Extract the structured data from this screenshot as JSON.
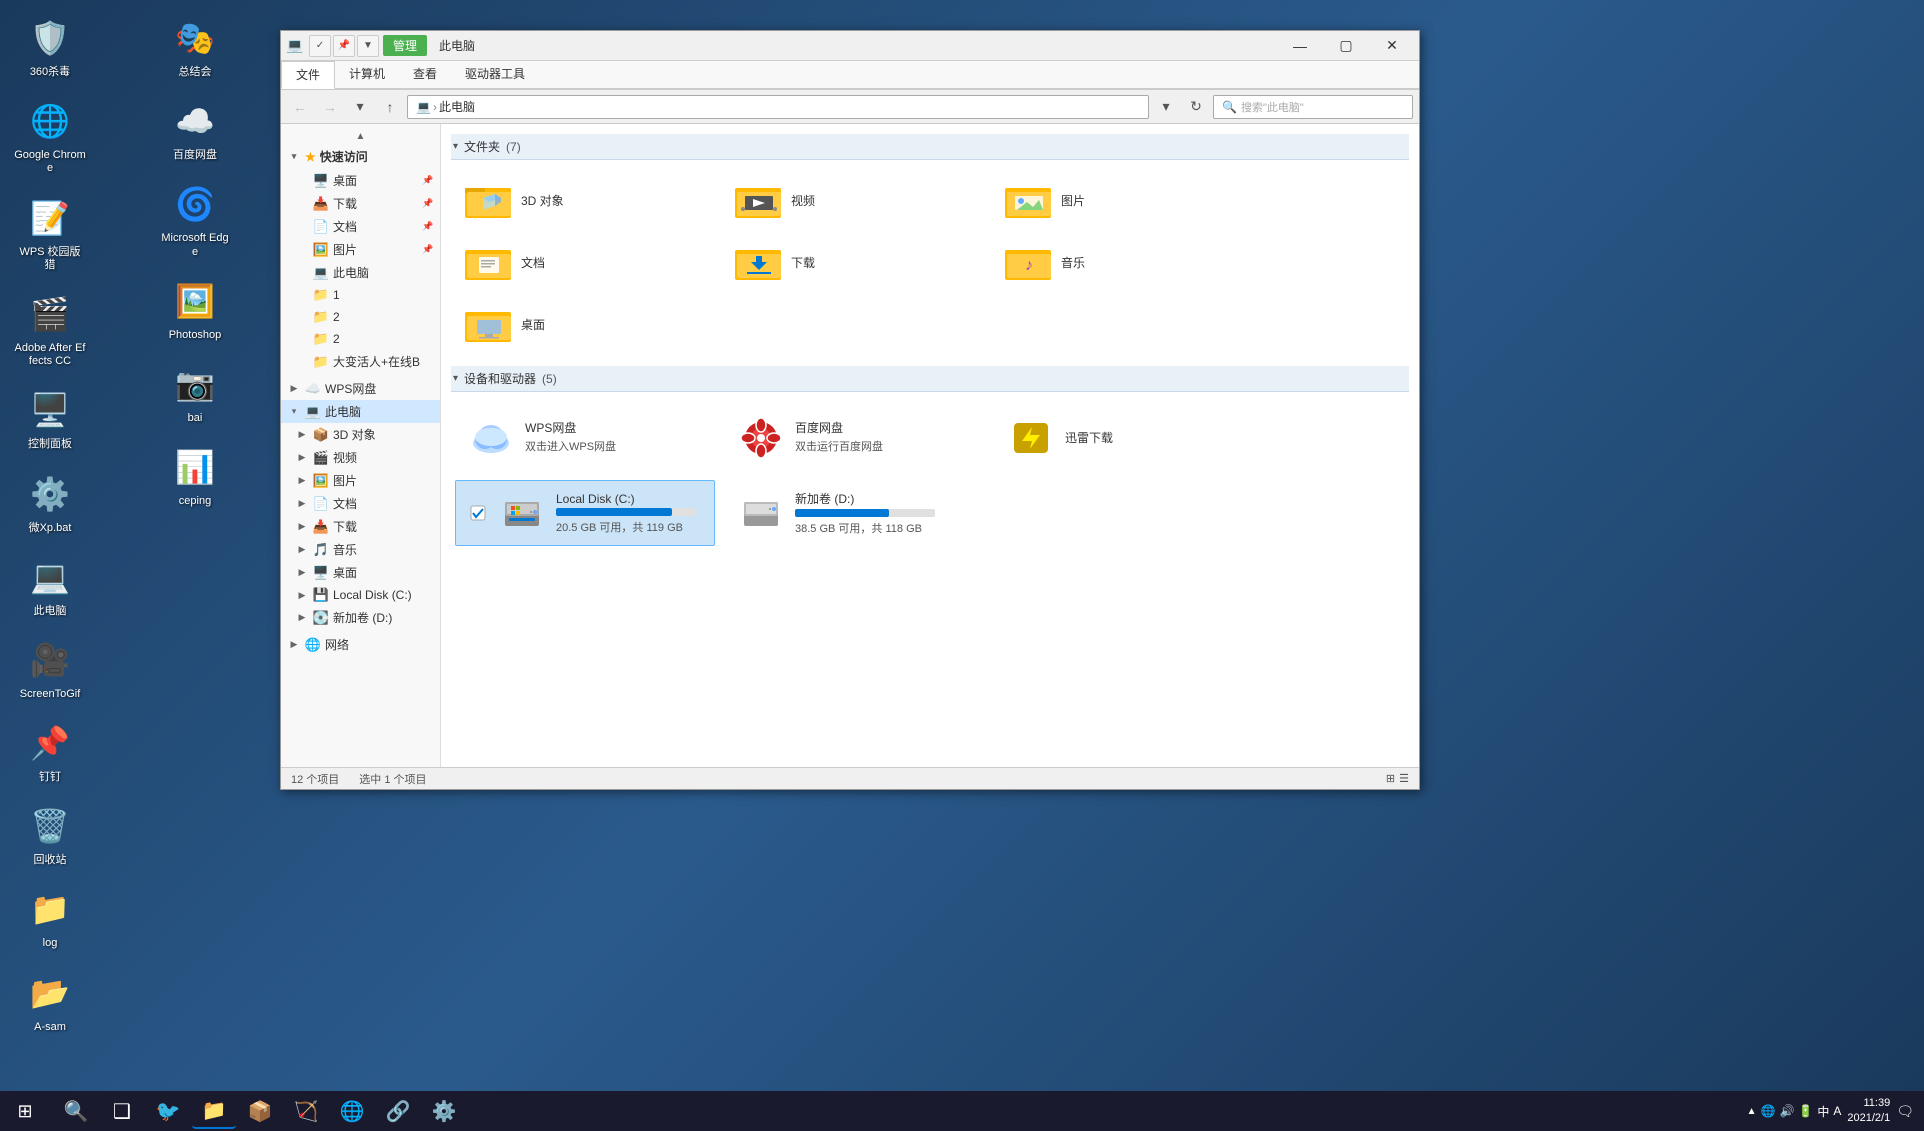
{
  "desktop": {
    "icons": [
      {
        "id": "360",
        "label": "360杀毒",
        "icon": "🛡️"
      },
      {
        "id": "chrome",
        "label": "Google Chrome",
        "icon": "🌐"
      },
      {
        "id": "wps",
        "label": "WPS 校园版 猎",
        "icon": "📝"
      },
      {
        "id": "ae",
        "label": "Adobe After Effects CC",
        "icon": "🎬"
      },
      {
        "id": "cpanel",
        "label": "控制面板",
        "icon": "🖥️"
      },
      {
        "id": "micropat",
        "label": "微Xp.bat",
        "icon": "⚙️"
      },
      {
        "id": "thispc",
        "label": "此电脑",
        "icon": "💻"
      },
      {
        "id": "screentogif",
        "label": "ScreenToGif",
        "icon": "🎥"
      },
      {
        "id": "nail",
        "label": "钉钉",
        "icon": "📌"
      },
      {
        "id": "recycle",
        "label": "回收站",
        "icon": "🗑️"
      },
      {
        "id": "log",
        "label": "log",
        "icon": "📁"
      },
      {
        "id": "asam",
        "label": "A-sam",
        "icon": "📂"
      },
      {
        "id": "zonghui",
        "label": "总结会",
        "icon": "🎭"
      },
      {
        "id": "baidupan",
        "label": "百度网盘",
        "icon": "☁️"
      },
      {
        "id": "edge",
        "label": "Microsoft Edge",
        "icon": "🌐"
      },
      {
        "id": "photoshop",
        "label": "Photoshop",
        "icon": "🖼️"
      },
      {
        "id": "bai",
        "label": "bai",
        "icon": "📷"
      },
      {
        "id": "ceping",
        "label": "ceping",
        "icon": "📊"
      }
    ]
  },
  "explorer": {
    "title": "此电脑",
    "ribbon_tabs": [
      {
        "id": "file",
        "label": "文件",
        "active": true
      },
      {
        "id": "computer",
        "label": "计算机"
      },
      {
        "id": "view",
        "label": "查看"
      },
      {
        "id": "driver_tools",
        "label": "驱动器工具"
      }
    ],
    "manage_tab": {
      "label": "管理"
    },
    "address": {
      "path_label": "此电脑",
      "path_icon": "💻",
      "search_placeholder": "搜索\"此电脑\""
    },
    "sidebar": {
      "quick_access": {
        "label": "快速访问",
        "expanded": true,
        "items": [
          {
            "id": "desktop-quick",
            "label": "桌面",
            "icon": "🖥️",
            "pinned": true
          },
          {
            "id": "downloads-quick",
            "label": "下载",
            "icon": "📥",
            "pinned": true
          },
          {
            "id": "docs-quick",
            "label": "文档",
            "icon": "📄",
            "pinned": true
          },
          {
            "id": "pics-quick",
            "label": "图片",
            "icon": "🖼️",
            "pinned": true
          },
          {
            "id": "thispc-quick",
            "label": "此电脑",
            "icon": "💻",
            "pinned": false
          }
        ],
        "sub_items": [
          {
            "id": "folder1",
            "label": "1",
            "icon": "📁"
          },
          {
            "id": "folder2",
            "label": "2",
            "icon": "📁"
          },
          {
            "id": "folder2b",
            "label": "2",
            "icon": "📁"
          },
          {
            "id": "folder-dabian",
            "label": "大变活人+在线B",
            "icon": "📁"
          }
        ]
      },
      "wps_cloud": {
        "label": "WPS网盘",
        "icon": "☁️",
        "expanded": false
      },
      "thispc": {
        "label": "此电脑",
        "icon": "💻",
        "expanded": true,
        "items": [
          {
            "id": "3d-obj",
            "label": "3D 对象",
            "icon": "📦"
          },
          {
            "id": "video",
            "label": "视频",
            "icon": "🎬"
          },
          {
            "id": "pics",
            "label": "图片",
            "icon": "🖼️"
          },
          {
            "id": "docs",
            "label": "文档",
            "icon": "📄"
          },
          {
            "id": "downloads",
            "label": "下载",
            "icon": "📥"
          },
          {
            "id": "music",
            "label": "音乐",
            "icon": "🎵"
          },
          {
            "id": "desk",
            "label": "桌面",
            "icon": "🖥️"
          },
          {
            "id": "local-c",
            "label": "Local Disk (C:)",
            "icon": "💾"
          },
          {
            "id": "new-d",
            "label": "新加卷 (D:)",
            "icon": "💽"
          }
        ]
      },
      "network": {
        "label": "网络",
        "icon": "🌐",
        "expanded": false
      }
    },
    "folders_section": {
      "title": "文件夹",
      "count": 7,
      "folders": [
        {
          "id": "3d",
          "name": "3D 对象",
          "icon": "📦"
        },
        {
          "id": "video",
          "name": "视频",
          "icon": "🎬"
        },
        {
          "id": "picture",
          "name": "图片",
          "icon": "🖼️"
        },
        {
          "id": "document",
          "name": "文档",
          "icon": "📄"
        },
        {
          "id": "download",
          "name": "下载",
          "icon": "📥"
        },
        {
          "id": "music",
          "name": "音乐",
          "icon": "🎵"
        },
        {
          "id": "desktop",
          "name": "桌面",
          "icon": "🖥️"
        }
      ]
    },
    "drives_section": {
      "title": "设备和驱动器",
      "count": 5,
      "drives": [
        {
          "id": "wps-cloud",
          "name": "WPS网盘",
          "subtitle": "双击进入WPS网盘",
          "icon": "☁️",
          "type": "cloud",
          "show_bar": false
        },
        {
          "id": "baidu-cloud",
          "name": "百度网盘",
          "subtitle": "双击运行百度网盘",
          "icon": "🔴",
          "type": "baidu",
          "show_bar": false
        },
        {
          "id": "thunder",
          "name": "迅雷下载",
          "subtitle": "",
          "icon": "⚡",
          "type": "thunder",
          "show_bar": false
        },
        {
          "id": "local-c",
          "name": "Local Disk (C:)",
          "subtitle": "",
          "icon": "💾",
          "type": "hdd",
          "show_bar": true,
          "free": "20.5 GB 可用，共 119 GB",
          "fill_pct": 83,
          "selected": true
        },
        {
          "id": "new-d",
          "name": "新加卷 (D:)",
          "subtitle": "",
          "icon": "💽",
          "type": "vol",
          "show_bar": true,
          "free": "38.5 GB 可用，共 118 GB",
          "fill_pct": 67,
          "selected": false
        }
      ]
    },
    "status_bar": {
      "item_count": "12 个项目",
      "selected": "选中 1 个项目"
    }
  },
  "taskbar": {
    "start_icon": "⊞",
    "items": [
      {
        "id": "search",
        "icon": "🔍",
        "active": false
      },
      {
        "id": "task-view",
        "icon": "❏",
        "active": false
      },
      {
        "id": "explorer",
        "icon": "📁",
        "active": true
      },
      {
        "id": "store",
        "icon": "📦",
        "active": false
      },
      {
        "id": "arrow",
        "icon": "🐦",
        "active": false
      },
      {
        "id": "chrome-task",
        "icon": "🌐",
        "active": false
      },
      {
        "id": "net-icon",
        "icon": "🔗",
        "active": false
      },
      {
        "id": "settings",
        "icon": "⚙️",
        "active": false
      }
    ],
    "tray": {
      "ime": "中",
      "ime2": "A",
      "time": "11:39",
      "date": "2021/2/1"
    }
  }
}
